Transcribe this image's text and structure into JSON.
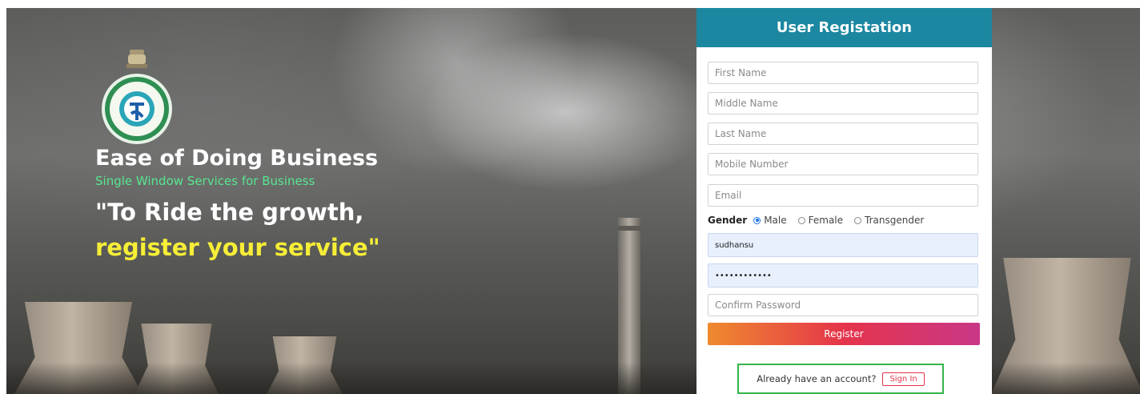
{
  "brand": {
    "title": "Ease of Doing Business",
    "subtitle": "Single Window Services for Business",
    "tagline_line1": "\"To Ride the growth,",
    "tagline_line2": "register your service\""
  },
  "form": {
    "header": "User Registation",
    "first_name_placeholder": "First Name",
    "middle_name_placeholder": "Middle Name",
    "last_name_placeholder": "Last Name",
    "mobile_placeholder": "Mobile Number",
    "email_placeholder": "Email",
    "gender": {
      "label": "Gender",
      "options": [
        "Male",
        "Female",
        "Transgender"
      ],
      "selected": "Male"
    },
    "username_value": "sudhansu",
    "password_value": "••••••••••••",
    "confirm_password_placeholder": "Confirm Password",
    "register_label": "Register",
    "signin_prompt": "Already have an account?",
    "signin_label": "Sign In"
  },
  "colors": {
    "header_bg": "#1c87a1",
    "subtitle_green": "#56e690",
    "tagline_yellow": "#f6ee36",
    "register_gradient": [
      "#ef8a2e",
      "#e5344b",
      "#c93887"
    ],
    "signin_outline": "#35b54a"
  },
  "icons": {
    "emblem": "west-bengal-emblem-icon"
  }
}
